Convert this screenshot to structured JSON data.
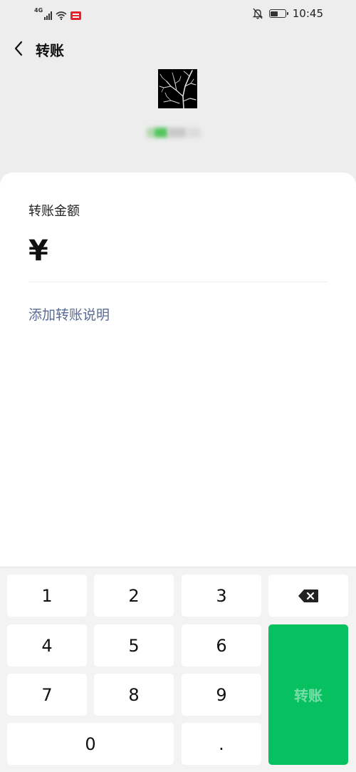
{
  "status_bar": {
    "network_type": "4G",
    "signal_level": 4,
    "battery_level": 0.6,
    "time": "10:45",
    "news_app_icon": "news-app-icon"
  },
  "header": {
    "back_icon": "chevron-left-icon",
    "title": "转账"
  },
  "recipient": {
    "avatar": "bare-tree-branches-image"
  },
  "form": {
    "amount_label": "转账金额",
    "currency_symbol": "¥",
    "amount_value": "",
    "add_note_link": "添加转账说明"
  },
  "keypad": {
    "keys": [
      "1",
      "2",
      "3",
      "4",
      "5",
      "6",
      "7",
      "8",
      "9",
      "0",
      "."
    ],
    "backspace_icon": "backspace-icon",
    "submit_label": "转账",
    "submit_enabled": false,
    "submit_color": "#07c160"
  },
  "colors": {
    "page_background": "#ededed",
    "link": "#576b95"
  }
}
